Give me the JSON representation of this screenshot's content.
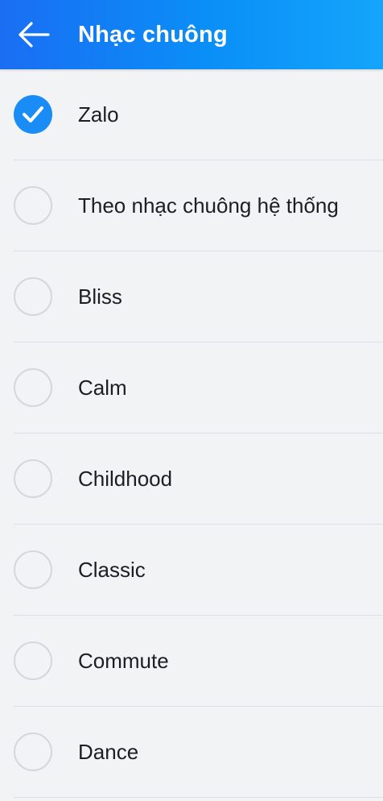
{
  "header": {
    "back_icon": "arrow-left-icon",
    "title": "Nhạc chuông"
  },
  "ringtones": [
    {
      "label": "Zalo",
      "selected": true
    },
    {
      "label": "Theo nhạc chuông hệ thống",
      "selected": false
    },
    {
      "label": "Bliss",
      "selected": false
    },
    {
      "label": "Calm",
      "selected": false
    },
    {
      "label": "Childhood",
      "selected": false
    },
    {
      "label": "Classic",
      "selected": false
    },
    {
      "label": "Commute",
      "selected": false
    },
    {
      "label": "Dance",
      "selected": false
    }
  ],
  "colors": {
    "header_start": "#1a6ef3",
    "header_end": "#14a5fb",
    "accent": "#1a8cf5",
    "background": "#f2f3f5"
  }
}
